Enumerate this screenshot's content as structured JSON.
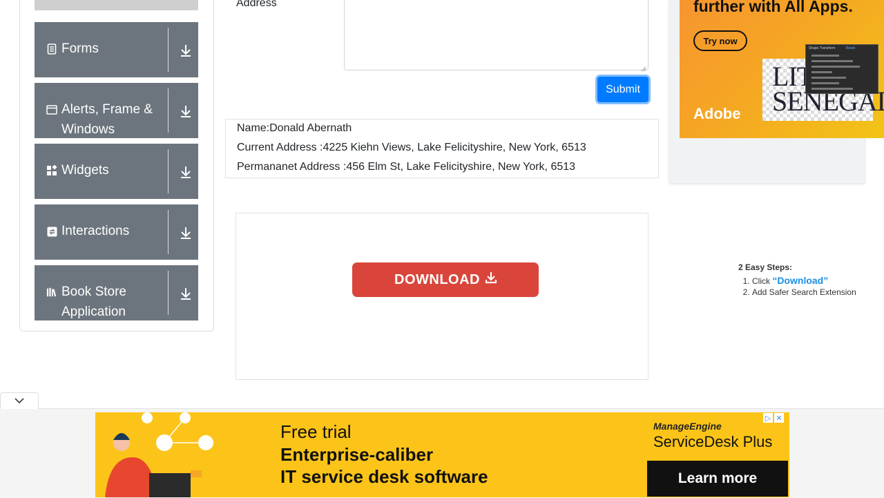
{
  "sidebar": {
    "groups": [
      {
        "label": "Forms",
        "icon": "document-icon"
      },
      {
        "label": "Alerts, Frame & Windows",
        "icon": "window-icon"
      },
      {
        "label": "Widgets",
        "icon": "widgets-icon"
      },
      {
        "label": "Interactions",
        "icon": "interactions-icon"
      },
      {
        "label": "Book Store Application",
        "icon": "books-icon"
      }
    ]
  },
  "form": {
    "address_label": "Address",
    "submit_label": "Submit"
  },
  "output": {
    "name": "Name:Donald Abernath",
    "current_address": "Current Address :4225 Kiehn Views, Lake Felicityshire, New York, 6513",
    "permanent_address": "Permananet Address :456 Elm St, Lake Felicityshire, New York, 6513"
  },
  "download_ad": {
    "button_label": "DOWNLOAD",
    "steps_title": "2 Easy Steps:",
    "step1_prefix": "Click ",
    "step1_link": "“Download”",
    "step2": "Add Safer Search Extension"
  },
  "adobe_ad": {
    "headline": "further with All Apps.",
    "try_label": "Try now",
    "logo": "Adobe",
    "poster_text_1": "LITTLE",
    "poster_text_2": "SENEGAL",
    "panel_title": "Shape Transform",
    "panel_reset": "Reset"
  },
  "bottom_ad": {
    "line1": "Free trial",
    "line2": "Enterprise-caliber",
    "line3": "IT service desk software",
    "brand_top": "ManageEngine",
    "brand_product": "ServiceDesk Plus",
    "cta": "Learn more"
  },
  "colors": {
    "sidebar_group_bg": "#6c757d",
    "submit_bg": "#007bff",
    "download_btn_bg": "#d9453b",
    "bottom_ad_bg": "#fcc419"
  }
}
